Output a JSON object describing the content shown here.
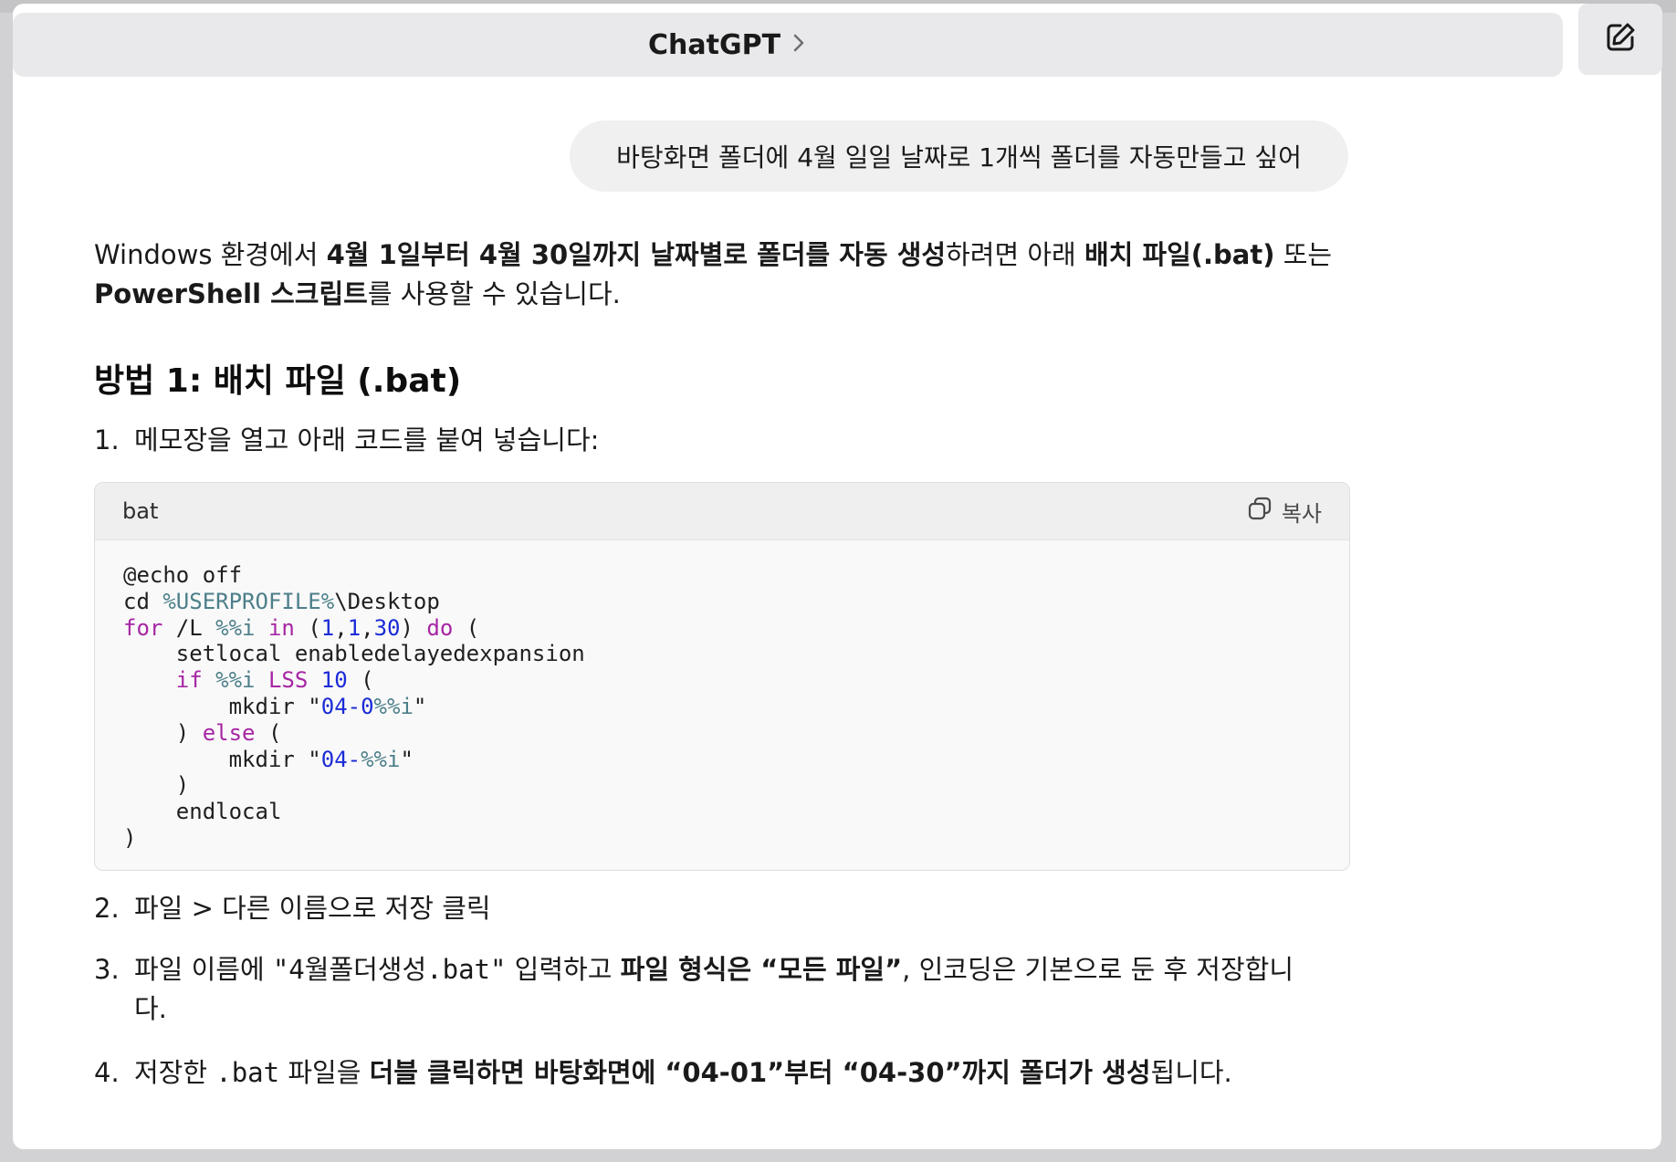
{
  "header": {
    "title": "ChatGPT",
    "chevron_icon": "chevron-right-icon",
    "new_chat_icon": "compose-icon"
  },
  "user_message": "바탕화면 폴더에 4월 일일 날짜로 1개씩 폴더를 자동만들고 싶어",
  "assistant": {
    "intro": {
      "t1": "Windows 환경에서 ",
      "b1": "4월 1일부터 4월 30일까지 날짜별로 폴더를 자동 생성",
      "t2": "하려면 아래 ",
      "b2": "배치 파일(.bat)",
      "t3": " 또는",
      "b3": "PowerShell 스크립트",
      "t4": "를 사용할 수 있습니다."
    },
    "heading": "방법 1: 배치 파일 (.bat)",
    "steps": [
      {
        "num": "1.",
        "text": "메모장을 열고 아래 코드를 붙여 넣습니다:"
      },
      {
        "num": "2.",
        "text": "파일 > 다른 이름으로 저장 클릭"
      },
      {
        "num": "3.",
        "t1": "파일 이름에 ",
        "code": "\"4월폴더생성.bat\"",
        "t2": " 입력하고 ",
        "b1": "파일 형식은 “모든 파일”",
        "t3": ", 인코딩은 기본으로 둔 후 저장합니",
        "t4": "다."
      },
      {
        "num": "4.",
        "t1": "저장한 ",
        "code": ".bat",
        "t2": " 파일을 ",
        "b1": "더블 클릭하면 바탕화면에 “04-01”부터 “04-30”까지 폴더가 생성",
        "t3": "됩니다."
      }
    ],
    "code_block": {
      "language": "bat",
      "copy_label": "복사",
      "copy_icon": "copy-icon"
    }
  },
  "colors": {
    "keyword": "#a626a4",
    "variable": "#4d7f8a",
    "number": "#1a2bd6",
    "bubble_bg": "#f0f0f0"
  }
}
